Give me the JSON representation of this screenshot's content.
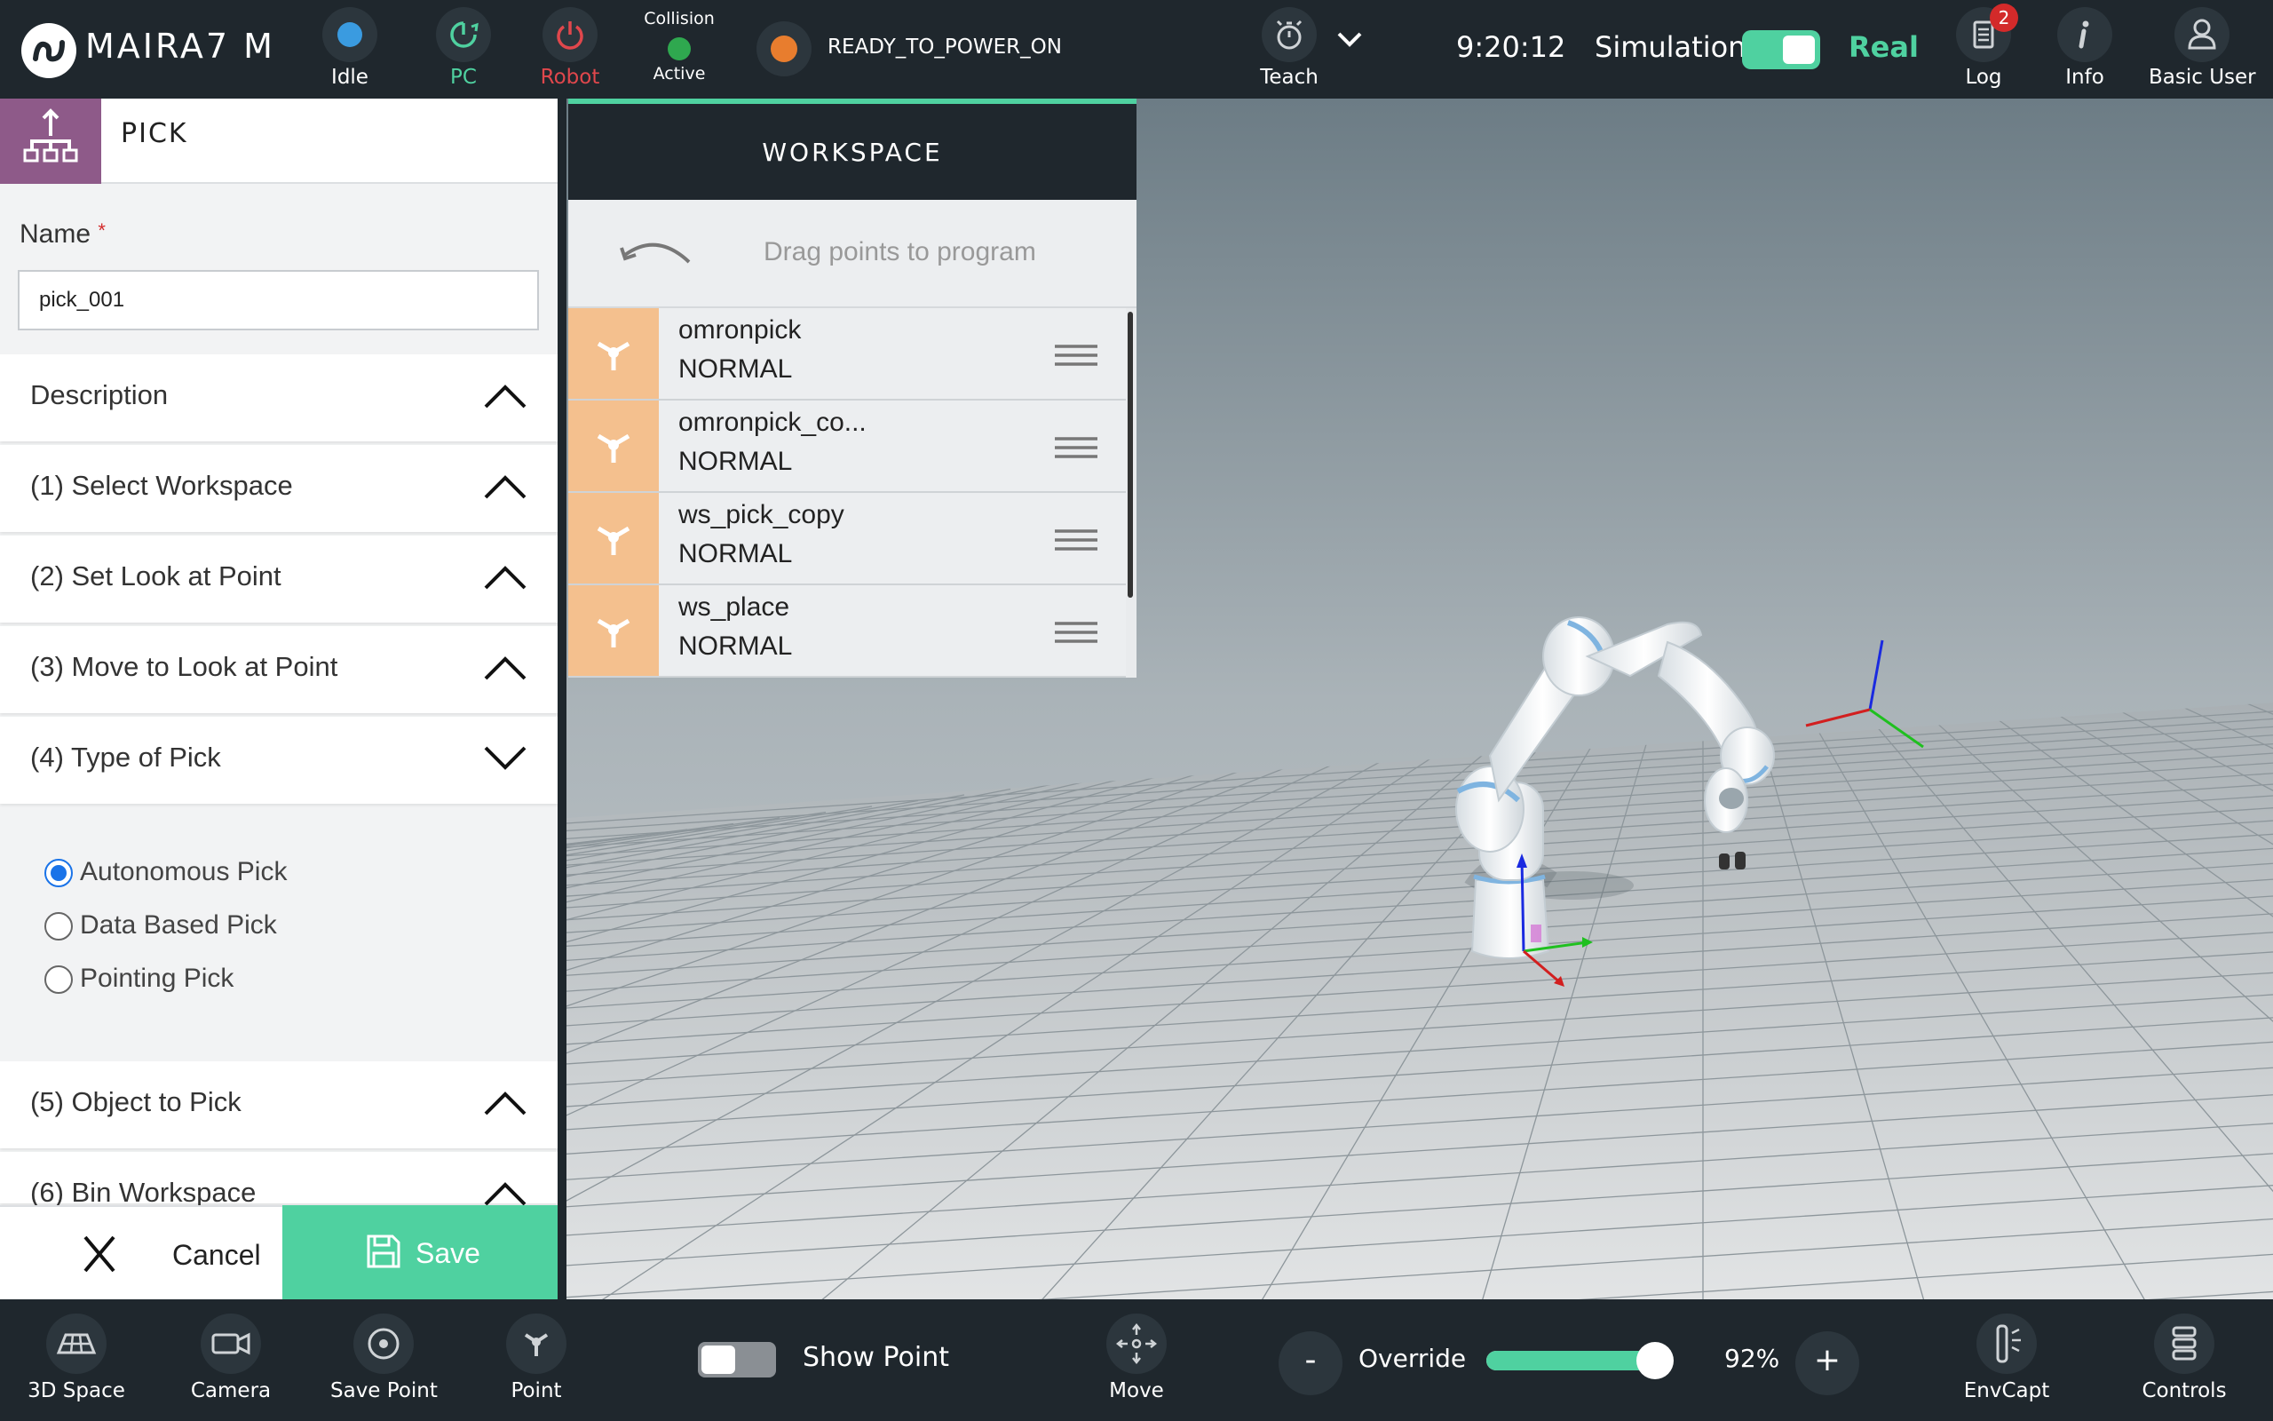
{
  "topbar": {
    "brand": "MAIRA7 M",
    "status_items": [
      {
        "label": "Idle",
        "icon": "status-dot-icon",
        "color": "#3a9be0"
      },
      {
        "label": "PC",
        "icon": "power-cycle-icon",
        "color": "#4fd1a0"
      },
      {
        "label": "Robot",
        "icon": "power-icon",
        "color": "#e0474c"
      }
    ],
    "collision": {
      "title": "Collision",
      "state": "Active",
      "color": "#2fa84f"
    },
    "power_state": {
      "text": "READY_TO_POWER_ON",
      "color": "#e87d2e"
    },
    "teach_label": "Teach",
    "time": "9:20:12",
    "simulation_label": "Simulation",
    "mode_label": "Real",
    "log": {
      "label": "Log",
      "badge": "2"
    },
    "info_label": "Info",
    "user_label": "Basic User"
  },
  "left_panel": {
    "title": "PICK",
    "name_label": "Name",
    "name_required_mark": "*",
    "name_value": "pick_001",
    "sections": [
      {
        "label": "Description",
        "expanded": false
      },
      {
        "label": "(1) Select Workspace",
        "expanded": false
      },
      {
        "label": "(2) Set Look at Point",
        "expanded": false
      },
      {
        "label": "(3) Move to Look at Point",
        "expanded": false
      },
      {
        "label": "(4) Type of Pick",
        "expanded": true
      },
      {
        "label": "(5) Object to Pick",
        "expanded": false
      },
      {
        "label": "(6) Bin Workspace",
        "expanded": false
      }
    ],
    "pick_types": [
      {
        "label": "Autonomous Pick",
        "selected": true
      },
      {
        "label": "Data Based Pick",
        "selected": false
      },
      {
        "label": "Pointing Pick",
        "selected": false
      }
    ],
    "cancel_label": "Cancel",
    "save_label": "Save"
  },
  "workspace": {
    "title": "WORKSPACE",
    "drag_hint": "Drag points to program",
    "points": [
      {
        "name": "omronpick",
        "mode": "NORMAL"
      },
      {
        "name": "omronpick_co...",
        "mode": "NORMAL"
      },
      {
        "name": "ws_pick_copy",
        "mode": "NORMAL"
      },
      {
        "name": "ws_place",
        "mode": "NORMAL"
      }
    ]
  },
  "bottombar": {
    "tools": [
      {
        "label": "3D Space",
        "icon": "grid-3d-icon"
      },
      {
        "label": "Camera",
        "icon": "camera-icon"
      },
      {
        "label": "Save Point",
        "icon": "target-icon"
      },
      {
        "label": "Point",
        "icon": "point-icon"
      }
    ],
    "show_point_label": "Show Point",
    "move_label": "Move",
    "override_minus": "-",
    "override_label": "Override",
    "override_value": 0.92,
    "override_text": "92%",
    "override_plus": "+",
    "envcapt_label": "EnvCapt",
    "controls_label": "Controls"
  },
  "colors": {
    "accent": "#4fd1a0",
    "topbar_bg": "#1f272d",
    "pick_icon_bg": "#8e5a89",
    "point_icon_bg": "#f4c08e"
  }
}
